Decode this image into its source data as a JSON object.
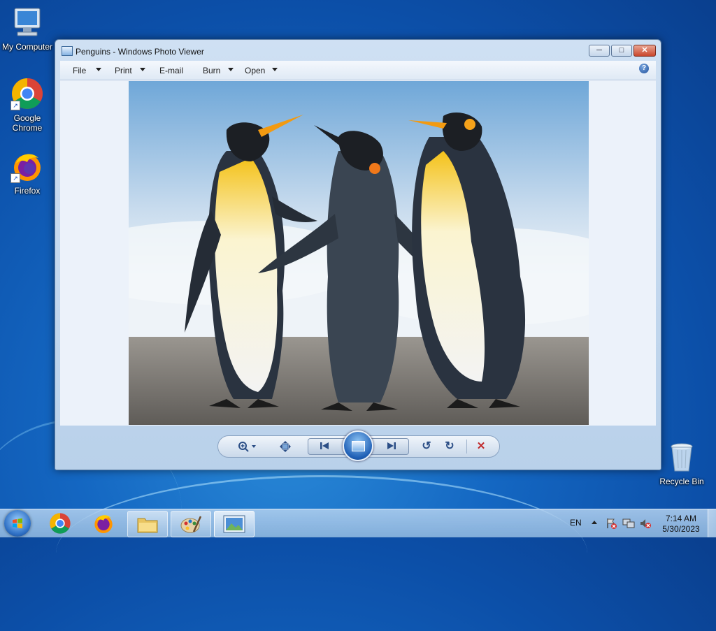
{
  "desktop": {
    "icons": [
      {
        "label": "My Computer"
      },
      {
        "label": "Google Chrome"
      },
      {
        "label": "Firefox"
      },
      {
        "label": "Recycle Bin"
      }
    ]
  },
  "window": {
    "title": "Penguins - Windows Photo Viewer",
    "buttons": {
      "minimize": "─",
      "maximize": "□",
      "close": "✕"
    },
    "menu": [
      {
        "label": "File",
        "has_dropdown": true
      },
      {
        "label": "Print",
        "has_dropdown": true
      },
      {
        "label": "E-mail",
        "has_dropdown": false
      },
      {
        "label": "Burn",
        "has_dropdown": true
      },
      {
        "label": "Open",
        "has_dropdown": true
      }
    ],
    "help_glyph": "?",
    "controls": {
      "zoom": "zoom-icon",
      "actual_size": "fit-window-icon",
      "previous": "previous-icon",
      "slideshow": "slideshow-icon",
      "next": "next-icon",
      "rotate_ccw": "↺",
      "rotate_cw": "↻",
      "delete": "✕"
    }
  },
  "taskbar": {
    "language": "EN",
    "clock": {
      "time": "7:14 AM",
      "date": "5/30/2023"
    },
    "pinned": [
      "Google Chrome",
      "Firefox",
      "Windows Explorer",
      "Paint",
      "Windows Photo Viewer"
    ]
  },
  "colors": {
    "accent": "#1467c2",
    "close_button": "#c9452b",
    "delete": "#c0282a"
  }
}
